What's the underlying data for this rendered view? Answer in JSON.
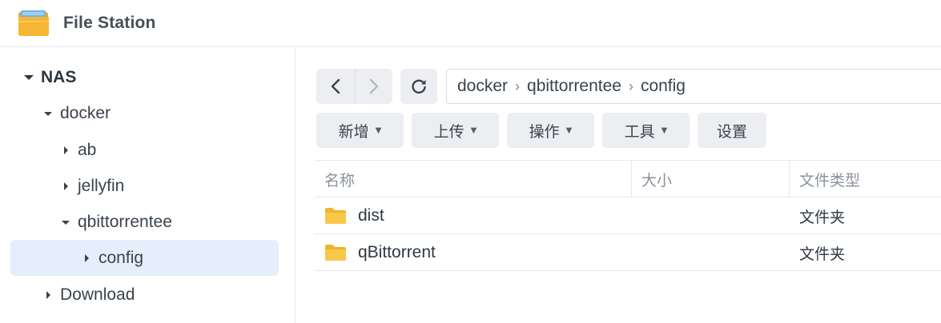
{
  "app": {
    "title": "File Station",
    "icon": "folder-app-icon"
  },
  "sidebar": {
    "root": "NAS",
    "items": [
      {
        "label": "docker",
        "expanded": true
      },
      {
        "label": "ab",
        "expanded": false
      },
      {
        "label": "jellyfin",
        "expanded": false
      },
      {
        "label": "qbittorrentee",
        "expanded": true
      },
      {
        "label": "config",
        "expanded": false,
        "selected": true
      },
      {
        "label": "Download",
        "expanded": false
      }
    ]
  },
  "nav": {
    "back_icon": "chevron-left-icon",
    "forward_icon": "chevron-right-icon",
    "refresh_icon": "refresh-icon"
  },
  "path": {
    "crumbs": [
      "docker",
      "qbittorrentee",
      "config"
    ]
  },
  "toolbar": {
    "new_label": "新增",
    "upload_label": "上传",
    "action_label": "操作",
    "tools_label": "工具",
    "settings_label": "设置"
  },
  "table": {
    "columns": [
      "名称",
      "大小",
      "文件类型"
    ],
    "rows": [
      {
        "name": "dist",
        "size": "",
        "type": "文件夹"
      },
      {
        "name": "qBittorrent",
        "size": "",
        "type": "文件夹"
      }
    ]
  },
  "colors": {
    "accent_selected": "#e5effb",
    "folder": "#f5c233",
    "button_bg": "#eceef1"
  }
}
